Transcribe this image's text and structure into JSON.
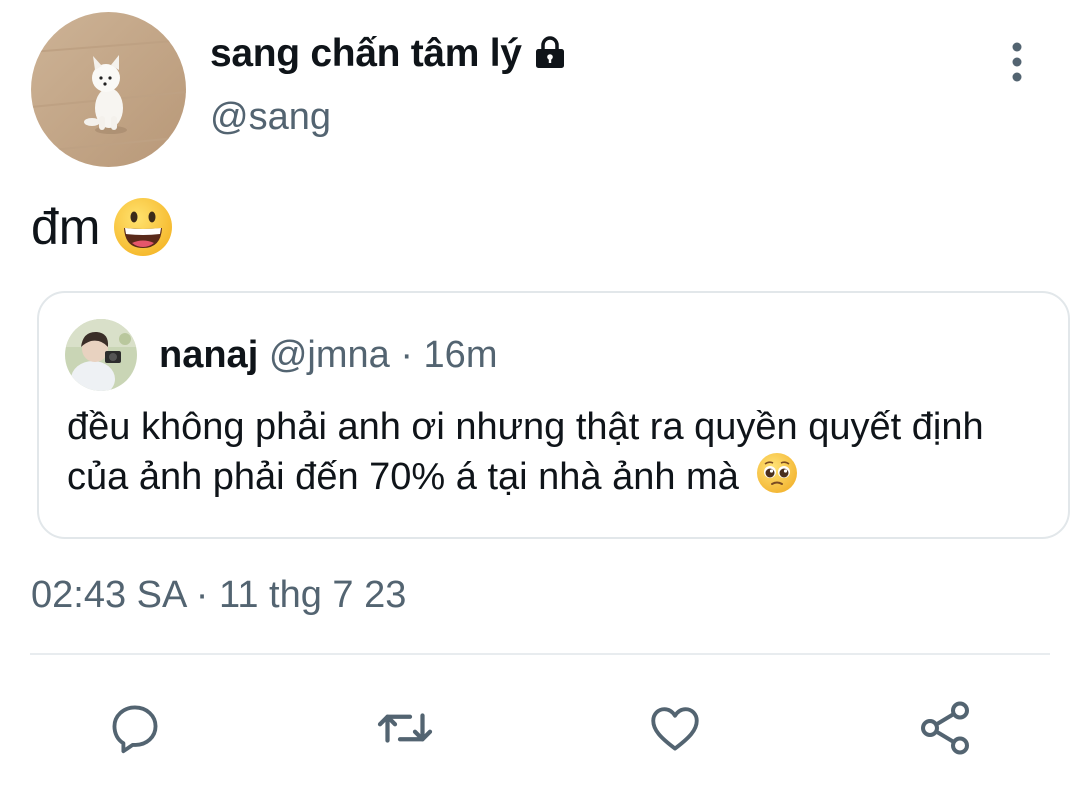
{
  "author": {
    "display_name": "sang chấn tâm lý",
    "handle": "@sang",
    "protected_icon": "lock-icon",
    "avatar": "white-puppy-avatar"
  },
  "tweet": {
    "text": "đm",
    "emoji": "grinning-face-emoji"
  },
  "quoted_tweet": {
    "display_name": "nanaj",
    "handle": "@jmna",
    "separator": " · ",
    "time_ago": "16m",
    "text": "đều không phải anh ơi nhưng thật ra quyền quyết định của ảnh phải đến 70% á tại nhà ảnh mà",
    "emoji": "pleading-face-emoji"
  },
  "timestamp": {
    "time": "02:43 SA",
    "separator": " · ",
    "date": "11 thg 7 23"
  },
  "actions": [
    "reply-icon",
    "retweet-icon",
    "like-icon",
    "share-icon"
  ],
  "colors": {
    "text_primary": "#0f1419",
    "text_secondary": "#536471",
    "border": "#e2e7ea"
  }
}
